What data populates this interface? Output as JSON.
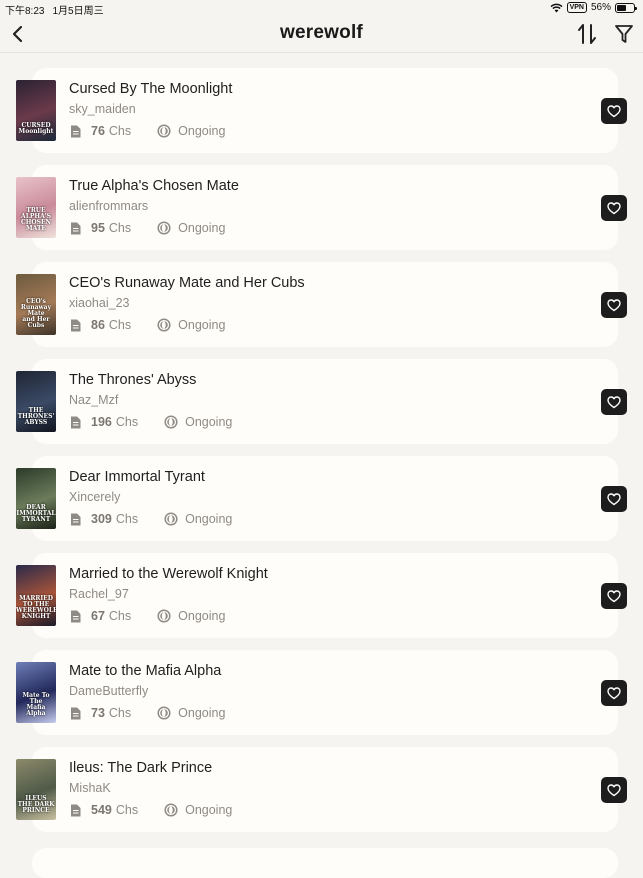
{
  "status_bar": {
    "time": "下午8:23",
    "date": "1月5日周三",
    "vpn": "VPN",
    "battery_percent": "56%",
    "battery_level": 0.56
  },
  "nav": {
    "title": "werewolf",
    "back_icon": "chevron-left-icon",
    "sort_icon": "sort-arrows-icon",
    "filter_icon": "filter-icon"
  },
  "colors": {
    "background": "#f6f4f1",
    "card": "#fffdfa",
    "favorite_button": "#1d1d1d",
    "secondary_text": "#8e8a85"
  },
  "chapters_suffix": "Chs",
  "books": [
    {
      "title": "Cursed By The Moonlight",
      "author": "sky_maiden",
      "chapters": "76",
      "status": "Ongoing",
      "cover_text": "CURSED\nMoonlight",
      "cover_colors": [
        "#2a2233",
        "#6b3a4a",
        "#1c2a3a"
      ]
    },
    {
      "title": "True Alpha's Chosen Mate",
      "author": "alienfrommars",
      "chapters": "95",
      "status": "Ongoing",
      "cover_text": "TRUE ALPHA'S\nCHOSEN MATE",
      "cover_colors": [
        "#e9c3c8",
        "#c98a9a",
        "#efe3dc"
      ]
    },
    {
      "title": "CEO's Runaway Mate and Her Cubs",
      "author": "xiaohai_23",
      "chapters": "86",
      "status": "Ongoing",
      "cover_text": "CEO's Runaway Mate\nand Her Cubs",
      "cover_colors": [
        "#6c5a3e",
        "#a47a57",
        "#3d3328"
      ]
    },
    {
      "title": "The Thrones' Abyss",
      "author": "Naz_Mzf",
      "chapters": "196",
      "status": "Ongoing",
      "cover_text": "THE THRONES'\nABYSS",
      "cover_colors": [
        "#1f2635",
        "#3b4a66",
        "#11151d"
      ]
    },
    {
      "title": "Dear Immortal Tyrant",
      "author": "Xincerely",
      "chapters": "309",
      "status": "Ongoing",
      "cover_text": "DEAR\nIMMORTAL\nTYRANT",
      "cover_colors": [
        "#2c3a2a",
        "#6b7c5a",
        "#1b2118"
      ]
    },
    {
      "title": "Married to the Werewolf Knight",
      "author": "Rachel_97",
      "chapters": "67",
      "status": "Ongoing",
      "cover_text": "MARRIED TO THE\nWEREWOLF KNIGHT",
      "cover_colors": [
        "#2a2a4a",
        "#a8543a",
        "#1a1a2a"
      ]
    },
    {
      "title": "Mate to the Mafia Alpha",
      "author": "DameButterfly",
      "chapters": "73",
      "status": "Ongoing",
      "cover_text": "Mate To The\nMafia Alpha",
      "cover_colors": [
        "#6e7fb8",
        "#22285a",
        "#c7cdee"
      ]
    },
    {
      "title": "Ileus: The Dark Prince",
      "author": "MishaK",
      "chapters": "549",
      "status": "Ongoing",
      "cover_text": "ILEUS\nTHE DARK\nPRINCE",
      "cover_colors": [
        "#8c8a6a",
        "#4f5a48",
        "#c9c0a0"
      ]
    }
  ]
}
